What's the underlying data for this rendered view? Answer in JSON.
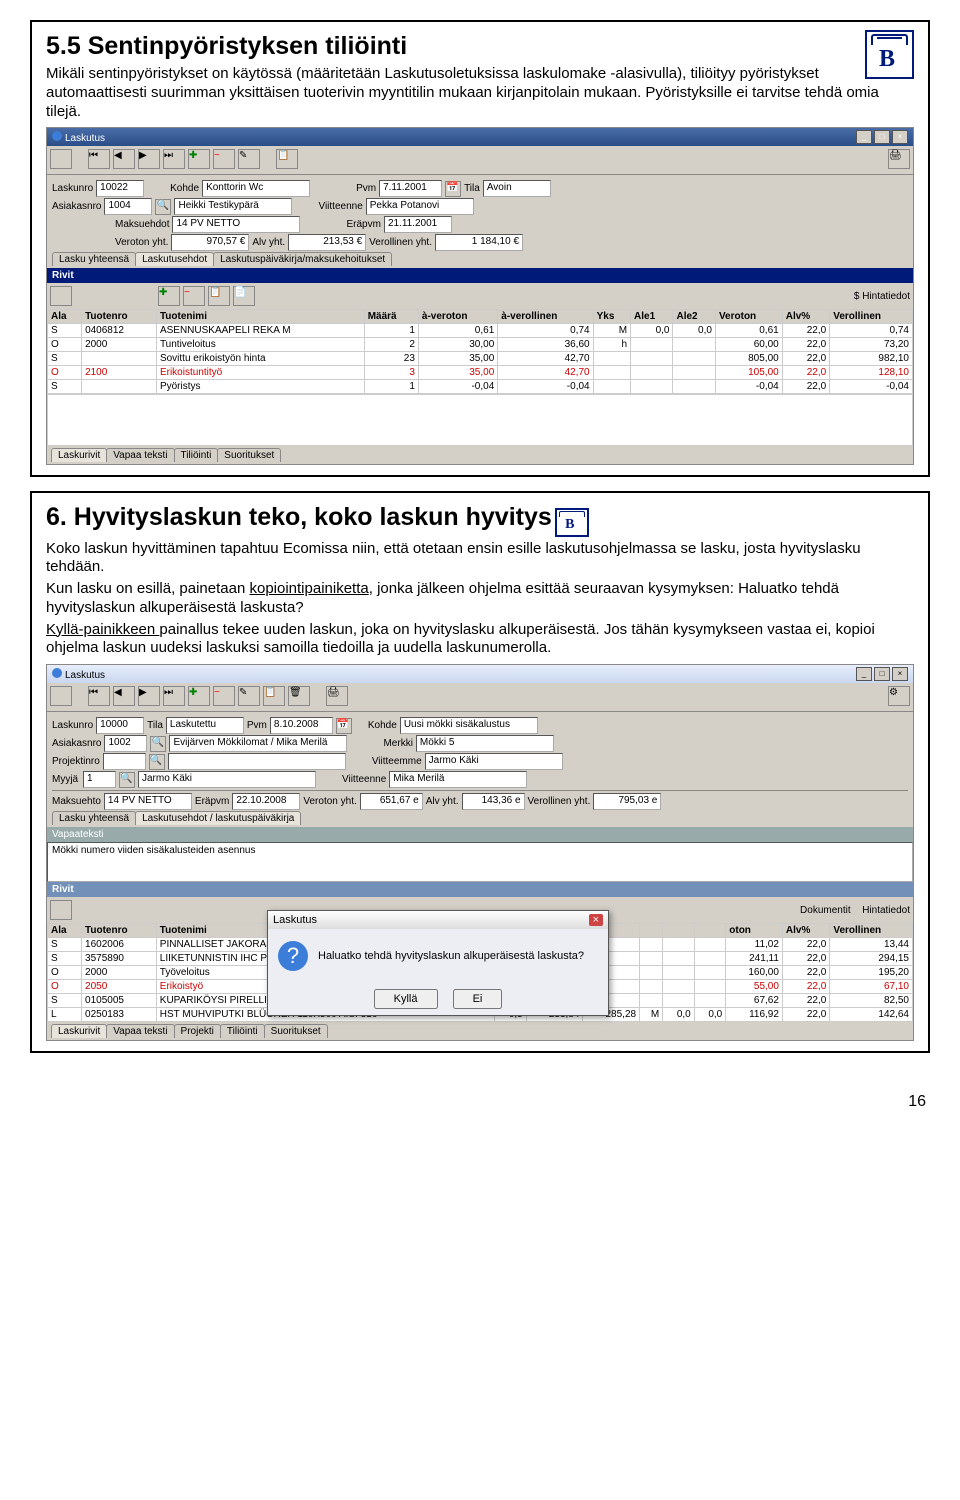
{
  "section1": {
    "heading": "5.5 Sentinpyöristyksen tiliöinti",
    "para": "Mikäli sentinpyöristykset on käytössä (määritetään Laskutusoletuksissa laskulomake -alasivulla), tiliöityy pyöristykset automaattisesti suurimman yksittäisen tuoterivin myyntitilin mukaan kirjanpitolain mukaan. Pyöristyksille ei tarvitse tehdä omia tilejä."
  },
  "app1": {
    "title": "Laskutus",
    "f": {
      "laskunro_l": "Laskunro",
      "laskunro": "10022",
      "kohde_l": "Kohde",
      "kohde": "Konttorin Wc",
      "pvm_l": "Pvm",
      "pvm": "7.11.2001",
      "tila_l": "Tila",
      "tila": "Avoin",
      "asiak_l": "Asiakasnro",
      "asiak": "1004",
      "asiak_n": "Heikki Testikypärä",
      "viit_l": "Viitteenne",
      "viit": "Pekka Potanovi",
      "maksu_l": "Maksuehdot",
      "maksu": "14 PV NETTO",
      "era_l": "Eräpvm",
      "era": "21.11.2001",
      "veroton_l": "Veroton yht.",
      "veroton": "970,57 €",
      "alv_l": "Alv yht.",
      "alv": "213,53 €",
      "verol_l": "Verollinen yht.",
      "verol": "1 184,10 €",
      "tabs": [
        "Lasku yhteensä",
        "Laskutusehdot",
        "Laskutuspäiväkirja/maksukehoitukset"
      ],
      "rivit": "Rivit",
      "ht": "Hintatiedot",
      "bottomTabs": [
        "Laskurivit",
        "Vapaa teksti",
        "Tiliöinti",
        "Suoritukset"
      ]
    },
    "cols": [
      "Ala",
      "Tuotenro",
      "Tuotenimi",
      "Määrä",
      "à-veroton",
      "à-verollinen",
      "Yks",
      "Ale1",
      "Ale2",
      "Veroton",
      "Alv%",
      "Verollinen"
    ],
    "rows": [
      [
        "S",
        "0406812",
        "ASENNUSKAAPELI REKA M",
        "1",
        "0,61",
        "0,74",
        "M",
        "0,0",
        "0,0",
        "0,61",
        "22,0",
        "0,74"
      ],
      [
        "O",
        "2000",
        "Tuntiveloitus",
        "2",
        "30,00",
        "36,60",
        "h",
        "",
        "",
        "60,00",
        "22,0",
        "73,20"
      ],
      [
        "S",
        "",
        "Sovittu erikoistyön hinta",
        "23",
        "35,00",
        "42,70",
        "",
        "",
        "",
        "805,00",
        "22,0",
        "982,10"
      ],
      [
        "O",
        "2100",
        "Erikoistuntityö",
        "3",
        "35,00",
        "42,70",
        "",
        "",
        "",
        "105,00",
        "22,0",
        "128,10"
      ],
      [
        "S",
        "",
        "Pyöristys",
        "1",
        "-0,04",
        "-0,04",
        "",
        "",
        "",
        "-0,04",
        "22,0",
        "-0,04"
      ]
    ]
  },
  "section2": {
    "heading": "6. Hyvityslaskun teko, koko laskun hyvitys",
    "p1": "Koko laskun hyvittäminen tapahtuu Ecomissa niin, että otetaan ensin esille laskutusohjelmassa se lasku, josta hyvityslasku tehdään.",
    "p2a": "Kun lasku on esillä, painetaan ",
    "p2b": "kopiointipainiketta",
    "p2c": ", jonka jälkeen ohjelma esittää seuraavan kysymyksen: Haluatko tehdä hyvityslaskun alkuperäisestä laskusta?",
    "p3a": "Kyllä-painikkeen ",
    "p3b": "painallus tekee uuden laskun, joka on hyvityslasku alkuperäisestä. Jos tähän kysymykseen vastaa ei, kopioi ohjelma laskun uudeksi laskuksi samoilla tiedoilla ja uudella laskunumerolla."
  },
  "app2": {
    "title": "Laskutus",
    "f": {
      "laskunro_l": "Laskunro",
      "laskunro": "10000",
      "tila_l": "Tila",
      "tila": "Laskutettu",
      "pvm_l": "Pvm",
      "pvm": "8.10.2008",
      "kohde_l": "Kohde",
      "kohde": "Uusi mökki sisäkalustus",
      "asiak_l": "Asiakasnro",
      "asiak": "1002",
      "asiak_n": "Evijärven Mökkilomat / Mika Merilä",
      "merkki_l": "Merkki",
      "merkki": "Mökki 5",
      "proj_l": "Projektinro",
      "viim_l": "Viitteemme",
      "viim": "Jarmo Käki",
      "myyja_l": "Myyjä",
      "myyja": "1",
      "myyja_n": "Jarmo Käki",
      "viit_l": "Viitteenne",
      "viit": "Mika Merilä",
      "maksu_l": "Maksuehto",
      "maksu": "14 PV NETTO",
      "era_l": "Eräpvm",
      "era": "22.10.2008",
      "veroton_l": "Veroton yht.",
      "veroton": "651,67 e",
      "alv_l": "Alv yht.",
      "alv": "143,36 e",
      "verol_l": "Verollinen yht.",
      "verol": "795,03 e",
      "tabs": [
        "Lasku yhteensä",
        "Laskutusehdot / laskutuspäiväkirja"
      ],
      "vt_l": "Vapaateksti",
      "vt": "Mökki numero viiden sisäkalusteiden asennus",
      "rivit": "Rivit",
      "dok": "Dokumentit",
      "ht": "Hintatiedot",
      "bottomTabs": [
        "Laskurivit",
        "Vapaa teksti",
        "Projekti",
        "Tiliöinti",
        "Suoritukset"
      ]
    },
    "cols": [
      "Ala",
      "Tuotenro",
      "Tuotenimi",
      "",
      "",
      "",
      "",
      "",
      "",
      "oton",
      "Alv%",
      "Verollinen"
    ],
    "rows": [
      [
        "S",
        "1602006",
        "PINNALLISET JAKORASIA A",
        "",
        "",
        "",
        "",
        "",
        "",
        "11,02",
        "22,0",
        "13,44"
      ],
      [
        "S",
        "3575890",
        "LIIKETUNNISTIN IHC PIR SE",
        "",
        "",
        "",
        "",
        "",
        "",
        "241,11",
        "22,0",
        "294,15"
      ],
      [
        "O",
        "2000",
        "Työveloitus",
        "",
        "",
        "",
        "",
        "",
        "",
        "160,00",
        "22,0",
        "195,20"
      ],
      [
        "O",
        "2050",
        "Erikoistyö",
        "",
        "",
        "",
        "",
        "",
        "",
        "55,00",
        "22,0",
        "67,10"
      ],
      [
        "S",
        "0105005",
        "KUPARIKÖYSI PIRELLI HK 1",
        "",
        "",
        "",
        "",
        "",
        "",
        "67,62",
        "22,0",
        "82,50"
      ],
      [
        "L",
        "0250183",
        "HST MUHVIPUTKI BLÜCHER 110X500 AISI 316",
        "0,5",
        "233,84",
        "285,28",
        "M",
        "0,0",
        "0,0",
        "116,92",
        "22,0",
        "142,64"
      ]
    ],
    "dlg": {
      "title": "Laskutus",
      "q": "Haluatko tehdä hyvityslaskun alkuperäisestä laskusta?",
      "yes": "Kyllä",
      "no": "Ei"
    }
  },
  "pageno": "16"
}
